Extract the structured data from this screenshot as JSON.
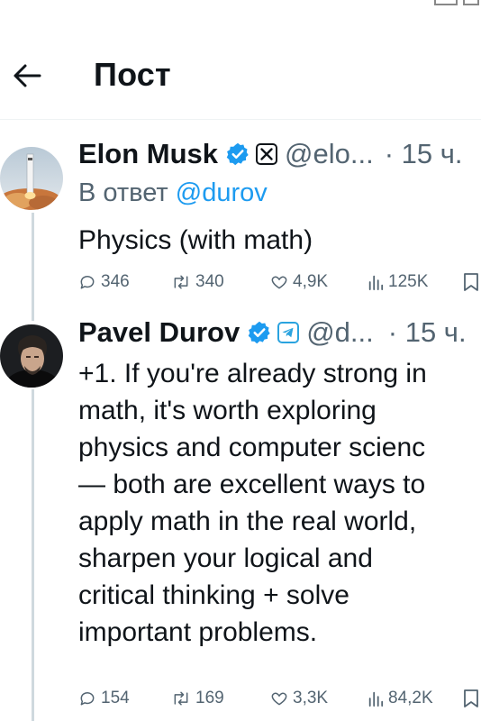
{
  "header": {
    "title": "Пост"
  },
  "tweets": [
    {
      "name": "Elon Musk",
      "handle": "@elo...",
      "time": "· 15 ч.",
      "reply_prefix": "В ответ",
      "reply_mention": "@durov",
      "text": "Physics (with math)",
      "stats": {
        "replies": "346",
        "reposts": "340",
        "likes": "4,9K",
        "views": "125K"
      }
    },
    {
      "name": "Pavel Durov",
      "handle": "@d...",
      "time": "· 15 ч.",
      "lines": [
        "+1. If you're already strong in",
        "math, it's worth exploring",
        "physics and computer scienc",
        "— both are excellent ways to",
        "apply math in the real world,",
        "sharpen your logical and",
        "critical thinking + solve",
        "important problems."
      ],
      "stats": {
        "replies": "154",
        "reposts": "169",
        "likes": "3,3K",
        "views": "84,2K"
      }
    }
  ],
  "icons": {
    "back": "arrow-left-icon",
    "verified": "verified-badge-icon",
    "x_affiliation": "x-logo-icon",
    "telegram_affiliation": "telegram-icon",
    "reply": "comment-icon",
    "repost": "repost-icon",
    "like": "heart-icon",
    "views": "views-bar-icon",
    "bookmark": "bookmark-icon"
  },
  "colors": {
    "verified": "#1d9bf0",
    "link": "#1d9bf0",
    "muted": "#536471",
    "text": "#0f1419"
  }
}
